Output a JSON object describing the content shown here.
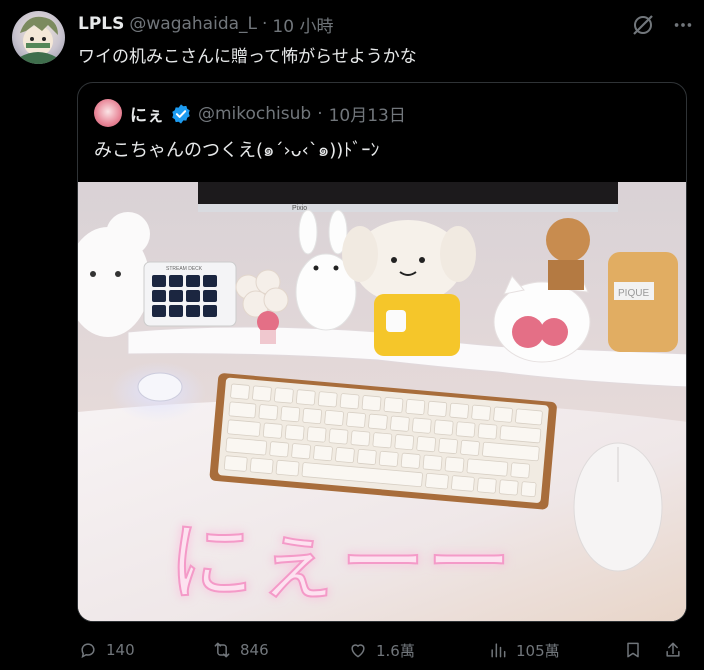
{
  "tweet": {
    "display_name": "LPLS",
    "handle": "@wagahaida_L",
    "dot": "·",
    "time": "10 小時",
    "text": "ワイの机みこさんに贈って怖がらせようかな"
  },
  "quote": {
    "display_name": "にぇ",
    "handle": "@mikochisub",
    "dot": "·",
    "date": "10月13日",
    "text": "みこちゃんのつくえ(๑´›ᴗ‹`๑))ﾄﾞｰﾝ",
    "photo_overlay_text": "にぇーー",
    "photo_monitor_label": "Pixio",
    "photo_stream_deck_label": "STREAM DECK",
    "photo_mug_label": "PIQUE"
  },
  "actions": {
    "replies": "140",
    "retweets": "846",
    "likes": "1.6萬",
    "views": "105萬"
  },
  "colors": {
    "background": "#000000",
    "text_primary": "#e7e9ea",
    "text_secondary": "#71767b",
    "border": "#2f3336",
    "verified_blue": "#1d9bf0"
  },
  "icons": [
    "avatar",
    "grok-icon",
    "more-icon",
    "verified-badge-icon",
    "reply-icon",
    "retweet-icon",
    "like-icon",
    "views-icon",
    "bookmark-icon",
    "share-icon"
  ]
}
